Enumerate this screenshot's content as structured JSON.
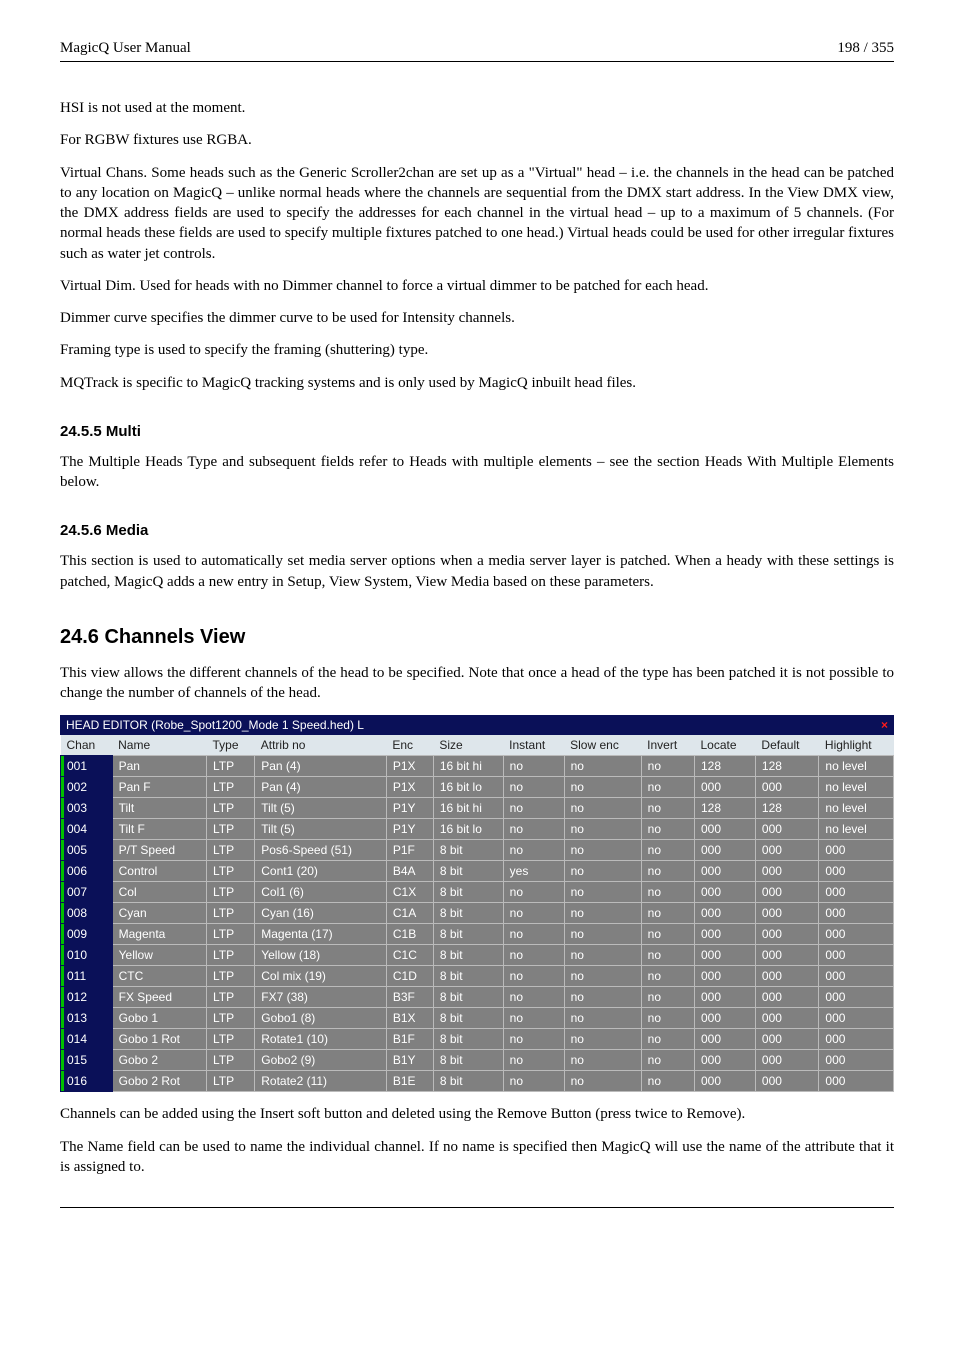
{
  "header": {
    "title": "MagicQ User Manual",
    "page": "198 / 355"
  },
  "body": {
    "p1": "HSI is not used at the moment.",
    "p2": "For RGBW fixtures use RGBA.",
    "p3": "Virtual Chans. Some heads such as the Generic Scroller2chan are set up as a \"Virtual\" head – i.e. the channels in the head can be patched to any location on MagicQ – unlike normal heads where the channels are sequential from the DMX start address. In the View DMX view, the DMX address fields are used to specify the addresses for each channel in the virtual head – up to a maximum of 5 channels. (For normal heads these fields are used to specify multiple fixtures patched to one head.) Virtual heads could be used for other irregular fixtures such as water jet controls.",
    "p4": "Virtual Dim. Used for heads with no Dimmer channel to force a virtual dimmer to be patched for each head.",
    "p5": "Dimmer curve specifies the dimmer curve to be used for Intensity channels.",
    "p6": "Framing type is used to specify the framing (shuttering) type.",
    "p7": "MQTrack is specific to MagicQ tracking systems and is only used by MagicQ inbuilt head files.",
    "h_multi": "24.5.5   Multi",
    "p_multi": "The Multiple Heads Type and subsequent fields refer to Heads with multiple elements – see the section Heads With Multiple Elements below.",
    "h_media": "24.5.6   Media",
    "p_media": "This section is used to automatically set media server options when a media server layer is patched. When a heady with these settings is patched, MagicQ adds a new entry in Setup, View System, View Media based on these parameters.",
    "h_chan": "24.6   Channels View",
    "p_chan": "This view allows the different channels of the head to be specified. Note that once a head of the type has been patched it is not possible to change the number of channels of the head.",
    "p_after_tbl": "Channels can be added using the Insert soft button and deleted using the Remove Button (press twice to Remove).",
    "p_after_tbl2": "The Name field can be used to name the individual channel. If no name is specified then MagicQ will use the name of the attribute that it is assigned to."
  },
  "editor": {
    "title": "HEAD EDITOR (Robe_Spot1200_Mode 1 Speed.hed) L",
    "close": "×",
    "columns": [
      "Chan",
      "Name",
      "Type",
      "Attrib no",
      "Enc",
      "Size",
      "Instant",
      "Slow enc",
      "Invert",
      "Locate",
      "Default",
      "Highlight"
    ],
    "rows": [
      {
        "chan": "001",
        "name": "Pan",
        "type": "LTP",
        "attr": "Pan (4)",
        "enc": "P1X",
        "size": "16 bit hi",
        "instant": "no",
        "slow": "no",
        "invert": "no",
        "locate": "128",
        "default": "128",
        "hl": "no level"
      },
      {
        "chan": "002",
        "name": "Pan F",
        "type": "LTP",
        "attr": "Pan (4)",
        "enc": "P1X",
        "size": "16 bit lo",
        "instant": "no",
        "slow": "no",
        "invert": "no",
        "locate": "000",
        "default": "000",
        "hl": "no level"
      },
      {
        "chan": "003",
        "name": "Tilt",
        "type": "LTP",
        "attr": "Tilt (5)",
        "enc": "P1Y",
        "size": "16 bit hi",
        "instant": "no",
        "slow": "no",
        "invert": "no",
        "locate": "128",
        "default": "128",
        "hl": "no level"
      },
      {
        "chan": "004",
        "name": "Tilt F",
        "type": "LTP",
        "attr": "Tilt (5)",
        "enc": "P1Y",
        "size": "16 bit lo",
        "instant": "no",
        "slow": "no",
        "invert": "no",
        "locate": "000",
        "default": "000",
        "hl": "no level"
      },
      {
        "chan": "005",
        "name": "P/T Speed",
        "type": "LTP",
        "attr": "Pos6-Speed (51)",
        "enc": "P1F",
        "size": "8 bit",
        "instant": "no",
        "slow": "no",
        "invert": "no",
        "locate": "000",
        "default": "000",
        "hl": "000"
      },
      {
        "chan": "006",
        "name": "Control",
        "type": "LTP",
        "attr": "Cont1 (20)",
        "enc": "B4A",
        "size": "8 bit",
        "instant": "yes",
        "slow": "no",
        "invert": "no",
        "locate": "000",
        "default": "000",
        "hl": "000"
      },
      {
        "chan": "007",
        "name": "Col",
        "type": "LTP",
        "attr": "Col1 (6)",
        "enc": "C1X",
        "size": "8 bit",
        "instant": "no",
        "slow": "no",
        "invert": "no",
        "locate": "000",
        "default": "000",
        "hl": "000"
      },
      {
        "chan": "008",
        "name": "Cyan",
        "type": "LTP",
        "attr": "Cyan (16)",
        "enc": "C1A",
        "size": "8 bit",
        "instant": "no",
        "slow": "no",
        "invert": "no",
        "locate": "000",
        "default": "000",
        "hl": "000"
      },
      {
        "chan": "009",
        "name": "Magenta",
        "type": "LTP",
        "attr": "Magenta (17)",
        "enc": "C1B",
        "size": "8 bit",
        "instant": "no",
        "slow": "no",
        "invert": "no",
        "locate": "000",
        "default": "000",
        "hl": "000"
      },
      {
        "chan": "010",
        "name": "Yellow",
        "type": "LTP",
        "attr": "Yellow (18)",
        "enc": "C1C",
        "size": "8 bit",
        "instant": "no",
        "slow": "no",
        "invert": "no",
        "locate": "000",
        "default": "000",
        "hl": "000"
      },
      {
        "chan": "011",
        "name": "CTC",
        "type": "LTP",
        "attr": "Col mix (19)",
        "enc": "C1D",
        "size": "8 bit",
        "instant": "no",
        "slow": "no",
        "invert": "no",
        "locate": "000",
        "default": "000",
        "hl": "000"
      },
      {
        "chan": "012",
        "name": "FX Speed",
        "type": "LTP",
        "attr": "FX7 (38)",
        "enc": "B3F",
        "size": "8 bit",
        "instant": "no",
        "slow": "no",
        "invert": "no",
        "locate": "000",
        "default": "000",
        "hl": "000"
      },
      {
        "chan": "013",
        "name": "Gobo 1",
        "type": "LTP",
        "attr": "Gobo1 (8)",
        "enc": "B1X",
        "size": "8 bit",
        "instant": "no",
        "slow": "no",
        "invert": "no",
        "locate": "000",
        "default": "000",
        "hl": "000"
      },
      {
        "chan": "014",
        "name": "Gobo 1 Rot",
        "type": "LTP",
        "attr": "Rotate1 (10)",
        "enc": "B1F",
        "size": "8 bit",
        "instant": "no",
        "slow": "no",
        "invert": "no",
        "locate": "000",
        "default": "000",
        "hl": "000"
      },
      {
        "chan": "015",
        "name": "Gobo 2",
        "type": "LTP",
        "attr": "Gobo2 (9)",
        "enc": "B1Y",
        "size": "8 bit",
        "instant": "no",
        "slow": "no",
        "invert": "no",
        "locate": "000",
        "default": "000",
        "hl": "000"
      },
      {
        "chan": "016",
        "name": "Gobo 2 Rot",
        "type": "LTP",
        "attr": "Rotate2 (11)",
        "enc": "B1E",
        "size": "8 bit",
        "instant": "no",
        "slow": "no",
        "invert": "no",
        "locate": "000",
        "default": "000",
        "hl": "000"
      }
    ]
  }
}
